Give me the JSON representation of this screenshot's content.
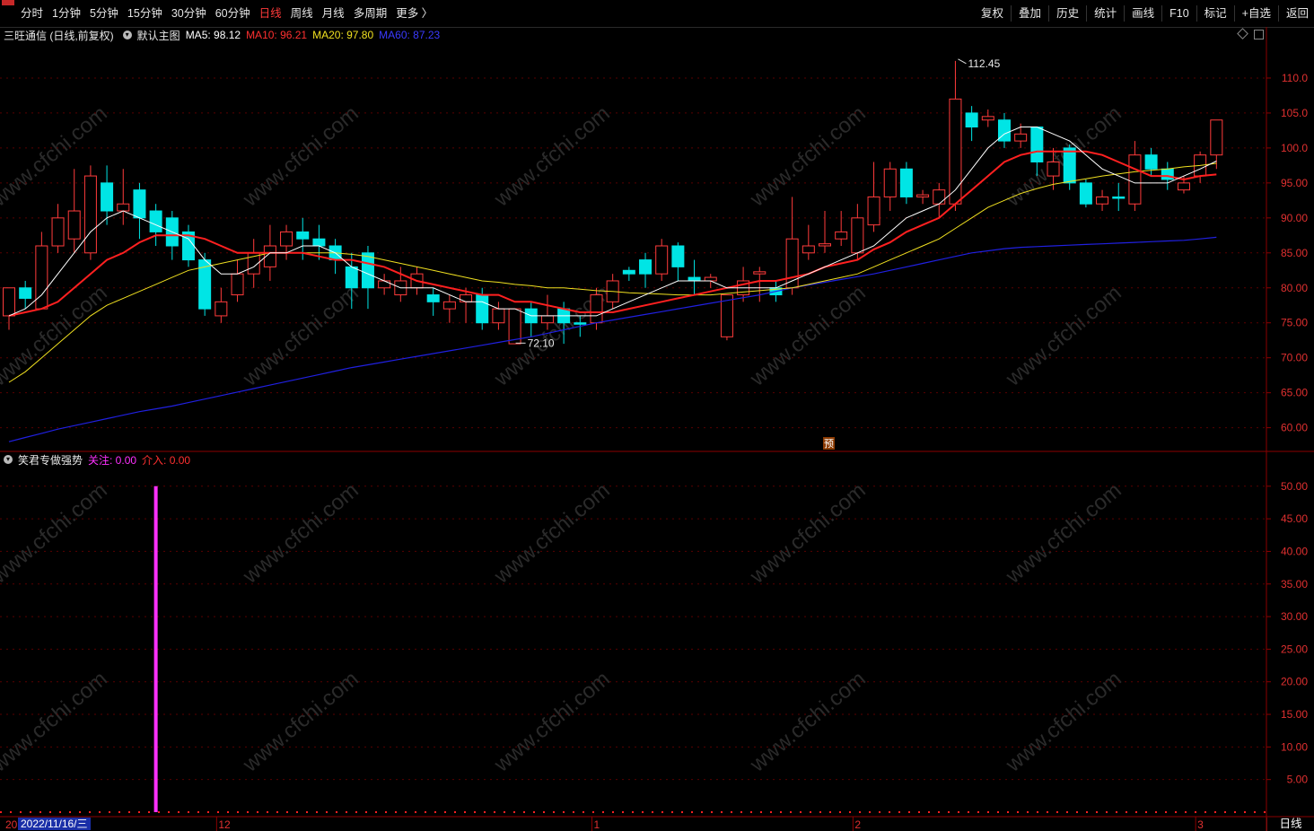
{
  "toolbar": {
    "periods": [
      "分时",
      "1分钟",
      "5分钟",
      "15分钟",
      "30分钟",
      "60分钟",
      "日线",
      "周线",
      "月线",
      "多周期",
      "更多 〉"
    ],
    "active_period": "日线",
    "right_items": [
      "复权",
      "叠加",
      "历史",
      "统计",
      "画线",
      "F10",
      "标记",
      "+自选",
      "返回"
    ]
  },
  "main_panel": {
    "stock": "三旺通信 (日线,前复权)",
    "template": "默认主图",
    "ma5": "MA5: 98.12",
    "ma10": "MA10: 96.21",
    "ma20": "MA20: 97.80",
    "ma60": "MA60: 87.23",
    "high_label": "112.45",
    "low_label": "72.10",
    "pre_label": "预",
    "y_ticks": [
      "110.0",
      "105.0",
      "100.0",
      "95.00",
      "90.00",
      "85.00",
      "80.00",
      "75.00",
      "70.00",
      "65.00",
      "60.00"
    ]
  },
  "indicator_panel": {
    "name": "笑君专做强势",
    "guanzhu": "关注: 0.00",
    "jieru": "介入: 0.00",
    "y_ticks": [
      "50.00",
      "45.00",
      "40.00",
      "35.00",
      "30.00",
      "25.00",
      "20.00",
      "15.00",
      "10.00",
      "5.00"
    ]
  },
  "time_axis": {
    "cursor_date": "2022/11/16/三",
    "left_stub": "20",
    "month_ticks": [
      "12",
      "1",
      "2",
      "3"
    ]
  },
  "bottom_tab": "日线",
  "watermark": "www.cfchi.com",
  "colors": {
    "up": "#ff3b3b",
    "down": "#00e5e5",
    "ma5": "#ffffff",
    "ma10": "#ff2020",
    "ma20": "#f0e020",
    "ma60": "#2020e0",
    "signal": "#ff30ff",
    "axis": "#8b0000"
  },
  "chart_data": {
    "type": "candlestick",
    "price_range": [
      57,
      115
    ],
    "candles": [
      {
        "o": 76,
        "c": 80,
        "h": 80,
        "l": 74
      },
      {
        "o": 80,
        "c": 78.5,
        "h": 81,
        "l": 77
      },
      {
        "o": 77,
        "c": 86,
        "h": 88,
        "l": 77
      },
      {
        "o": 86,
        "c": 90,
        "h": 92,
        "l": 85
      },
      {
        "o": 87,
        "c": 91,
        "h": 97,
        "l": 85
      },
      {
        "o": 85,
        "c": 96,
        "h": 97.5,
        "l": 84
      },
      {
        "o": 95,
        "c": 91,
        "h": 97.5,
        "l": 89
      },
      {
        "o": 91,
        "c": 92,
        "h": 97,
        "l": 89
      },
      {
        "o": 94,
        "c": 90,
        "h": 95,
        "l": 87
      },
      {
        "o": 91,
        "c": 88,
        "h": 92,
        "l": 86
      },
      {
        "o": 90,
        "c": 86,
        "h": 91,
        "l": 84
      },
      {
        "o": 88,
        "c": 84,
        "h": 89,
        "l": 83
      },
      {
        "o": 84,
        "c": 77,
        "h": 85,
        "l": 76
      },
      {
        "o": 76,
        "c": 78,
        "h": 80,
        "l": 75
      },
      {
        "o": 79,
        "c": 82,
        "h": 84,
        "l": 78
      },
      {
        "o": 82,
        "c": 85,
        "h": 87,
        "l": 80
      },
      {
        "o": 83,
        "c": 86,
        "h": 89,
        "l": 81
      },
      {
        "o": 86,
        "c": 88,
        "h": 89,
        "l": 84
      },
      {
        "o": 88,
        "c": 87,
        "h": 90,
        "l": 84
      },
      {
        "o": 87,
        "c": 86,
        "h": 89,
        "l": 84
      },
      {
        "o": 86,
        "c": 84,
        "h": 87,
        "l": 82
      },
      {
        "o": 83,
        "c": 80,
        "h": 85,
        "l": 77
      },
      {
        "o": 85,
        "c": 80,
        "h": 86,
        "l": 77
      },
      {
        "o": 80,
        "c": 81,
        "h": 82,
        "l": 79
      },
      {
        "o": 79,
        "c": 81,
        "h": 83,
        "l": 78
      },
      {
        "o": 80,
        "c": 82,
        "h": 83,
        "l": 79
      },
      {
        "o": 79,
        "c": 78,
        "h": 80,
        "l": 76
      },
      {
        "o": 77,
        "c": 78,
        "h": 79,
        "l": 75
      },
      {
        "o": 78,
        "c": 79,
        "h": 80,
        "l": 75
      },
      {
        "o": 79,
        "c": 75,
        "h": 80,
        "l": 74
      },
      {
        "o": 75,
        "c": 77,
        "h": 78,
        "l": 74
      },
      {
        "o": 72,
        "c": 77,
        "h": 77,
        "l": 72
      },
      {
        "o": 77,
        "c": 75,
        "h": 78,
        "l": 73
      },
      {
        "o": 75,
        "c": 76,
        "h": 79,
        "l": 74
      },
      {
        "o": 77,
        "c": 75,
        "h": 78,
        "l": 72
      },
      {
        "o": 75,
        "c": 74.8,
        "h": 76,
        "l": 73
      },
      {
        "o": 75,
        "c": 79,
        "h": 80,
        "l": 74
      },
      {
        "o": 78,
        "c": 81,
        "h": 82,
        "l": 77
      },
      {
        "o": 82.5,
        "c": 82,
        "h": 83,
        "l": 81
      },
      {
        "o": 84,
        "c": 82,
        "h": 85,
        "l": 80
      },
      {
        "o": 82,
        "c": 86,
        "h": 87,
        "l": 81
      },
      {
        "o": 86,
        "c": 83,
        "h": 86.5,
        "l": 81
      },
      {
        "o": 81.5,
        "c": 81,
        "h": 84,
        "l": 79
      },
      {
        "o": 81,
        "c": 81.5,
        "h": 82,
        "l": 80
      },
      {
        "o": 73,
        "c": 79,
        "h": 79,
        "l": 72.5
      },
      {
        "o": 79,
        "c": 81,
        "h": 83,
        "l": 78
      },
      {
        "o": 82,
        "c": 82.3,
        "h": 83,
        "l": 78
      },
      {
        "o": 80,
        "c": 79,
        "h": 81,
        "l": 78
      },
      {
        "o": 80,
        "c": 87,
        "h": 93,
        "l": 79
      },
      {
        "o": 85,
        "c": 86,
        "h": 89,
        "l": 84
      },
      {
        "o": 86,
        "c": 86.3,
        "h": 91,
        "l": 85
      },
      {
        "o": 87,
        "c": 88,
        "h": 91,
        "l": 86
      },
      {
        "o": 85,
        "c": 90,
        "h": 92,
        "l": 84
      },
      {
        "o": 89,
        "c": 93,
        "h": 98,
        "l": 88
      },
      {
        "o": 93,
        "c": 97,
        "h": 98,
        "l": 91
      },
      {
        "o": 97,
        "c": 93,
        "h": 98,
        "l": 92
      },
      {
        "o": 93,
        "c": 93.3,
        "h": 94,
        "l": 92
      },
      {
        "o": 92,
        "c": 94,
        "h": 95,
        "l": 90
      },
      {
        "o": 92,
        "c": 107,
        "h": 112.45,
        "l": 91
      },
      {
        "o": 105,
        "c": 103,
        "h": 106,
        "l": 101
      },
      {
        "o": 104,
        "c": 104.5,
        "h": 105.5,
        "l": 103
      },
      {
        "o": 104,
        "c": 101,
        "h": 105,
        "l": 100
      },
      {
        "o": 101,
        "c": 102,
        "h": 103.5,
        "l": 100
      },
      {
        "o": 103,
        "c": 98,
        "h": 103,
        "l": 96
      },
      {
        "o": 96,
        "c": 98,
        "h": 100,
        "l": 94
      },
      {
        "o": 100,
        "c": 95,
        "h": 100.5,
        "l": 94
      },
      {
        "o": 95,
        "c": 92,
        "h": 95.5,
        "l": 91.5
      },
      {
        "o": 92,
        "c": 93,
        "h": 94,
        "l": 91
      },
      {
        "o": 93,
        "c": 92.8,
        "h": 95,
        "l": 91
      },
      {
        "o": 92,
        "c": 99,
        "h": 101,
        "l": 91
      },
      {
        "o": 99,
        "c": 97,
        "h": 100,
        "l": 96
      },
      {
        "o": 97,
        "c": 95.5,
        "h": 98,
        "l": 94
      },
      {
        "o": 94,
        "c": 95,
        "h": 96,
        "l": 93.5
      },
      {
        "o": 96,
        "c": 99,
        "h": 99.5,
        "l": 95
      },
      {
        "o": 99,
        "c": 104,
        "h": 104,
        "l": 97
      }
    ],
    "ma5": [
      76,
      77,
      79,
      82,
      85,
      88,
      90,
      91,
      90,
      89,
      88,
      87,
      84,
      82,
      82,
      83,
      85,
      85,
      86,
      86,
      85,
      83,
      82,
      81,
      80,
      80,
      80,
      79,
      78,
      78,
      77,
      77,
      76,
      76,
      76,
      76,
      76,
      77,
      78,
      79,
      80,
      81,
      81,
      81,
      80,
      80,
      80,
      80,
      81,
      82,
      83,
      84,
      85,
      86,
      88,
      90,
      91,
      92,
      94,
      97,
      100,
      102,
      103,
      103,
      102,
      101,
      99,
      97,
      96,
      95,
      95,
      95,
      96,
      97,
      98.12
    ],
    "ma10": [
      76,
      76.5,
      77,
      78,
      80,
      82,
      84,
      85,
      86.5,
      87.5,
      87.5,
      87.5,
      87,
      86,
      85,
      85,
      85,
      85,
      85,
      84.5,
      84,
      84,
      83.5,
      83,
      82,
      81,
      80.5,
      80,
      79.5,
      79,
      79,
      78,
      78,
      77.5,
      77,
      76.5,
      76.5,
      76.5,
      77,
      77.5,
      78,
      78.5,
      79,
      79.5,
      80,
      80.5,
      81,
      81,
      81.5,
      82,
      83,
      83.5,
      84,
      85.5,
      86.5,
      88,
      89,
      90,
      92,
      94,
      96,
      98,
      99,
      99.5,
      99.5,
      99.5,
      99.5,
      99,
      98,
      97,
      96,
      96,
      95.5,
      96,
      96.21
    ],
    "ma20": [
      66.5,
      68,
      70,
      72,
      74,
      76,
      77.5,
      78.5,
      79.5,
      80.5,
      81.5,
      82.5,
      83,
      83.5,
      84,
      84.5,
      85,
      85,
      85,
      85,
      85,
      84.8,
      84.5,
      84,
      83.5,
      83,
      82.5,
      82,
      81.5,
      81,
      80.8,
      80.5,
      80.3,
      80,
      80,
      79.8,
      79.6,
      79.5,
      79.3,
      79.2,
      79.1,
      79,
      79,
      79,
      79.2,
      79.4,
      79.6,
      79.8,
      80,
      80.5,
      81,
      81.5,
      82,
      83,
      84,
      85,
      86,
      87,
      88.5,
      90,
      91.5,
      92.5,
      93.5,
      94.2,
      94.8,
      95.2,
      95.6,
      96,
      96.3,
      96.6,
      96.8,
      97,
      97.3,
      97.5,
      97.8
    ],
    "ma60": [
      58,
      58.6,
      59.2,
      59.8,
      60.3,
      60.8,
      61.3,
      61.8,
      62.3,
      62.7,
      63.1,
      63.6,
      64.1,
      64.6,
      65.1,
      65.6,
      66.1,
      66.6,
      67.1,
      67.6,
      68.1,
      68.6,
      69,
      69.4,
      69.8,
      70.2,
      70.6,
      71,
      71.4,
      71.8,
      72.2,
      72.6,
      73,
      73.5,
      74,
      74.5,
      75,
      75.4,
      75.8,
      76.2,
      76.6,
      77,
      77.4,
      77.8,
      78.2,
      78.6,
      79,
      79.5,
      80,
      80.4,
      80.8,
      81.2,
      81.6,
      82,
      82.5,
      83,
      83.5,
      84,
      84.5,
      85,
      85.3,
      85.6,
      85.8,
      85.9,
      86,
      86.1,
      86.2,
      86.3,
      86.4,
      86.5,
      86.6,
      86.7,
      86.8,
      87,
      87.23
    ],
    "signal_bar": {
      "index": 9,
      "value": 50
    },
    "indicator_range": [
      0,
      53
    ]
  }
}
